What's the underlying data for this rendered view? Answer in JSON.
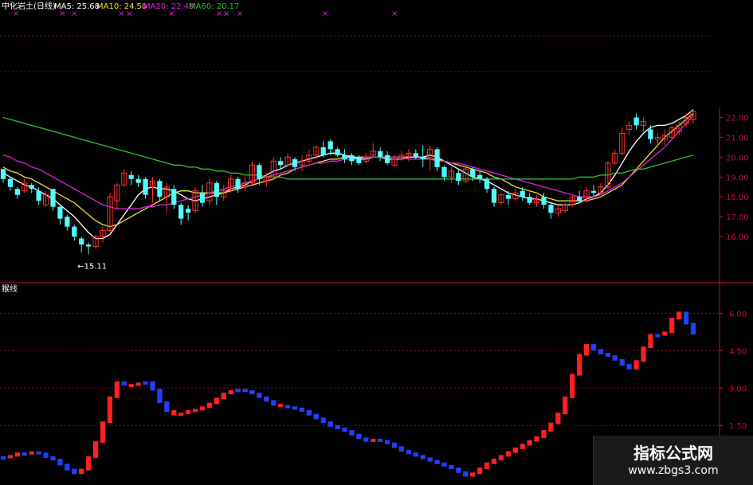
{
  "header": {
    "name": "中化岩土(日线)",
    "ma5_label": "MA5: 25.68",
    "ma10_label": "MA10: 24.50",
    "ma20_label": "MA20: 22.48",
    "ma60_label": "MA60: 20.17"
  },
  "lower_label": "猴线",
  "watermark": {
    "title": "指标公式网",
    "url": "www.zbgs3.com"
  },
  "colors": {
    "bg": "#000000",
    "grid": "#7a0a2a",
    "axis": "#c0103a",
    "up": "#ff3030",
    "down": "#54fcfc",
    "ma5": "#ffffff",
    "ma10": "#f0e040",
    "ma20": "#e020e0",
    "ma60": "#30c030",
    "ind_up": "#ff2020",
    "ind_down": "#2040ff"
  },
  "chart_data": [
    {
      "type": "candlestick",
      "title": "中化岩土(日线)",
      "ylim": [
        15.0,
        22.5
      ],
      "yticks": [
        16.0,
        17.0,
        18.0,
        19.0,
        20.0,
        21.0,
        22.0
      ],
      "ytick_labels": [
        "16.00",
        "17.00",
        "18.00",
        "19.00",
        "20.00",
        "21.00",
        "22.00"
      ],
      "low_annotation": "←15.11",
      "low_annotation_value": 15.11,
      "ohlc": [
        [
          19.4,
          19.4,
          18.7,
          18.9
        ],
        [
          18.9,
          19.0,
          18.3,
          18.5
        ],
        [
          18.4,
          18.5,
          17.9,
          18.1
        ],
        [
          18.3,
          18.9,
          18.2,
          18.7
        ],
        [
          18.6,
          18.7,
          18.2,
          18.4
        ],
        [
          18.3,
          18.5,
          17.6,
          17.8
        ],
        [
          17.6,
          18.3,
          17.5,
          18.1
        ],
        [
          18.4,
          18.4,
          17.3,
          17.5
        ],
        [
          17.5,
          17.6,
          16.6,
          16.9
        ],
        [
          17.0,
          17.1,
          16.3,
          16.5
        ],
        [
          16.5,
          16.6,
          15.8,
          16.0
        ],
        [
          15.9,
          16.0,
          15.2,
          15.6
        ],
        [
          15.6,
          15.7,
          15.11,
          15.5
        ],
        [
          15.5,
          16.1,
          15.4,
          16.0
        ],
        [
          16.0,
          16.5,
          15.7,
          16.3
        ],
        [
          16.3,
          18.2,
          16.2,
          18.0
        ],
        [
          17.8,
          18.7,
          17.4,
          18.6
        ],
        [
          18.6,
          19.4,
          18.5,
          19.2
        ],
        [
          19.1,
          19.3,
          18.6,
          18.9
        ],
        [
          18.9,
          19.1,
          18.5,
          18.7
        ],
        [
          18.9,
          19.0,
          17.9,
          18.1
        ],
        [
          18.5,
          19.0,
          17.7,
          18.8
        ],
        [
          18.8,
          18.9,
          17.8,
          18.0
        ],
        [
          18.0,
          18.7,
          17.2,
          18.5
        ],
        [
          18.4,
          18.6,
          17.4,
          17.6
        ],
        [
          17.6,
          17.7,
          16.6,
          16.9
        ],
        [
          17.4,
          17.6,
          16.8,
          17.2
        ],
        [
          17.3,
          18.5,
          17.2,
          18.3
        ],
        [
          18.2,
          18.6,
          17.5,
          17.7
        ],
        [
          17.8,
          18.9,
          17.6,
          18.7
        ],
        [
          18.7,
          18.8,
          17.6,
          18.0
        ],
        [
          18.0,
          18.6,
          17.8,
          18.3
        ],
        [
          18.4,
          19.1,
          18.2,
          18.9
        ],
        [
          18.9,
          19.0,
          18.2,
          18.4
        ],
        [
          18.5,
          19.0,
          18.3,
          18.7
        ],
        [
          18.7,
          19.8,
          18.6,
          19.6
        ],
        [
          19.6,
          19.7,
          18.6,
          18.9
        ],
        [
          18.8,
          19.2,
          18.5,
          19.0
        ],
        [
          19.0,
          20.0,
          18.9,
          19.8
        ],
        [
          19.8,
          20.0,
          19.4,
          19.6
        ],
        [
          19.6,
          20.2,
          19.5,
          20.0
        ],
        [
          19.9,
          20.0,
          19.3,
          19.5
        ],
        [
          19.6,
          20.1,
          19.3,
          19.8
        ],
        [
          19.8,
          20.4,
          19.7,
          20.1
        ],
        [
          20.1,
          20.6,
          19.9,
          20.5
        ],
        [
          20.5,
          20.8,
          20.0,
          20.1
        ],
        [
          20.8,
          20.9,
          20.1,
          20.4
        ],
        [
          20.4,
          20.5,
          20.0,
          20.1
        ],
        [
          20.1,
          20.4,
          19.7,
          19.9
        ],
        [
          20.1,
          20.2,
          19.6,
          19.8
        ],
        [
          20.0,
          20.1,
          19.6,
          19.7
        ],
        [
          19.8,
          20.2,
          19.7,
          20.0
        ],
        [
          20.1,
          20.7,
          20.0,
          20.3
        ],
        [
          20.3,
          20.5,
          19.8,
          20.0
        ],
        [
          20.1,
          20.3,
          19.6,
          19.7
        ],
        [
          19.6,
          20.1,
          19.5,
          19.9
        ],
        [
          19.9,
          20.3,
          19.8,
          20.1
        ],
        [
          20.1,
          20.4,
          19.8,
          20.2
        ],
        [
          20.2,
          20.4,
          19.9,
          20.0
        ],
        [
          20.0,
          20.6,
          19.5,
          19.9
        ],
        [
          20.0,
          20.6,
          19.3,
          20.4
        ],
        [
          20.4,
          20.5,
          19.3,
          19.5
        ],
        [
          19.5,
          19.6,
          18.8,
          19.0
        ],
        [
          19.0,
          19.5,
          18.7,
          19.3
        ],
        [
          19.2,
          19.4,
          18.6,
          18.8
        ],
        [
          18.8,
          19.5,
          18.7,
          19.4
        ],
        [
          19.4,
          19.5,
          18.8,
          19.0
        ],
        [
          19.1,
          19.3,
          18.7,
          18.9
        ],
        [
          18.9,
          19.0,
          18.2,
          18.4
        ],
        [
          18.4,
          18.5,
          17.5,
          17.7
        ],
        [
          17.7,
          18.2,
          17.6,
          18.1
        ],
        [
          18.1,
          18.3,
          17.6,
          17.9
        ],
        [
          17.9,
          18.4,
          17.8,
          18.2
        ],
        [
          18.3,
          18.5,
          17.8,
          18.0
        ],
        [
          18.0,
          18.2,
          17.6,
          17.7
        ],
        [
          17.7,
          18.1,
          17.5,
          17.9
        ],
        [
          18.0,
          18.2,
          17.4,
          17.6
        ],
        [
          17.6,
          17.7,
          16.9,
          17.2
        ],
        [
          17.2,
          17.6,
          17.0,
          17.4
        ],
        [
          17.3,
          17.7,
          17.2,
          17.6
        ],
        [
          17.6,
          18.1,
          17.5,
          18.0
        ],
        [
          18.0,
          18.3,
          17.7,
          17.8
        ],
        [
          17.8,
          18.5,
          17.7,
          18.3
        ],
        [
          18.3,
          18.6,
          18.0,
          18.2
        ],
        [
          18.2,
          18.7,
          18.1,
          18.5
        ],
        [
          18.5,
          19.8,
          18.4,
          19.7
        ],
        [
          19.7,
          20.4,
          19.6,
          20.2
        ],
        [
          20.2,
          21.5,
          20.1,
          21.2
        ],
        [
          21.4,
          21.8,
          21.1,
          21.6
        ],
        [
          22.0,
          22.2,
          21.4,
          21.6
        ],
        [
          21.6,
          22.0,
          21.3,
          21.8
        ],
        [
          21.4,
          21.6,
          20.7,
          20.9
        ],
        [
          20.9,
          21.2,
          20.5,
          21.0
        ],
        [
          20.9,
          21.4,
          20.6,
          21.1
        ],
        [
          21.0,
          21.6,
          20.9,
          21.5
        ],
        [
          21.3,
          21.8,
          21.1,
          21.6
        ],
        [
          21.7,
          22.2,
          21.5,
          22.0
        ],
        [
          21.9,
          22.4,
          21.7,
          22.3
        ]
      ],
      "series": [
        {
          "name": "MA5",
          "color": "#ffffff",
          "values": [
            19.2,
            19.0,
            18.8,
            18.6,
            18.5,
            18.3,
            18.1,
            17.9,
            17.6,
            17.3,
            17.0,
            16.6,
            16.2,
            15.9,
            15.9,
            16.1,
            16.6,
            17.1,
            17.6,
            18.1,
            18.4,
            18.5,
            18.4,
            18.4,
            18.3,
            18.1,
            17.9,
            17.8,
            17.9,
            18.0,
            18.1,
            18.2,
            18.4,
            18.5,
            18.6,
            18.8,
            18.9,
            19.1,
            19.3,
            19.4,
            19.6,
            19.7,
            19.8,
            19.9,
            20.0,
            20.1,
            20.2,
            20.2,
            20.1,
            20.0,
            19.9,
            19.9,
            20.0,
            20.0,
            19.9,
            19.9,
            19.9,
            20.0,
            20.0,
            20.0,
            20.1,
            20.0,
            19.8,
            19.6,
            19.4,
            19.2,
            19.0,
            18.9,
            18.8,
            18.6,
            18.4,
            18.2,
            18.1,
            18.0,
            17.9,
            17.9,
            17.8,
            17.7,
            17.6,
            17.6,
            17.6,
            17.7,
            17.9,
            18.0,
            18.2,
            18.6,
            19.1,
            19.7,
            20.3,
            20.8,
            21.2,
            21.5,
            21.6,
            21.6,
            21.7,
            21.9,
            22.1,
            22.4
          ]
        },
        {
          "name": "MA10",
          "color": "#f0e040",
          "values": [
            19.5,
            19.3,
            19.2,
            19.0,
            18.9,
            18.7,
            18.5,
            18.3,
            18.1,
            17.9,
            17.7,
            17.4,
            17.1,
            16.8,
            16.6,
            16.5,
            16.6,
            16.8,
            17.0,
            17.2,
            17.4,
            17.6,
            17.8,
            18.0,
            18.2,
            18.3,
            18.3,
            18.2,
            18.2,
            18.2,
            18.2,
            18.2,
            18.3,
            18.4,
            18.5,
            18.6,
            18.7,
            18.8,
            18.9,
            19.1,
            19.2,
            19.4,
            19.5,
            19.6,
            19.7,
            19.8,
            19.9,
            19.9,
            20.0,
            20.0,
            20.0,
            20.0,
            20.0,
            20.0,
            20.0,
            20.0,
            20.0,
            20.0,
            20.0,
            20.0,
            19.9,
            19.9,
            19.8,
            19.7,
            19.6,
            19.5,
            19.4,
            19.3,
            19.2,
            19.0,
            18.9,
            18.7,
            18.5,
            18.4,
            18.3,
            18.2,
            18.0,
            17.9,
            17.8,
            17.8,
            17.8,
            17.8,
            17.8,
            17.9,
            18.0,
            18.2,
            18.4,
            18.6,
            19.0,
            19.4,
            19.8,
            20.2,
            20.6,
            21.0,
            21.3,
            21.6,
            21.9,
            22.2
          ]
        },
        {
          "name": "MA20",
          "color": "#e020e0",
          "values": [
            20.1,
            20.0,
            19.8,
            19.7,
            19.5,
            19.4,
            19.2,
            19.0,
            18.8,
            18.6,
            18.4,
            18.2,
            18.0,
            17.8,
            17.6,
            17.5,
            17.4,
            17.4,
            17.4,
            17.4,
            17.5,
            17.5,
            17.6,
            17.6,
            17.7,
            17.8,
            17.9,
            18.0,
            18.1,
            18.2,
            18.3,
            18.4,
            18.5,
            18.6,
            18.7,
            18.8,
            18.9,
            19.0,
            19.1,
            19.2,
            19.3,
            19.4,
            19.5,
            19.6,
            19.7,
            19.7,
            19.8,
            19.8,
            19.9,
            19.9,
            19.9,
            20.0,
            20.0,
            20.0,
            20.0,
            20.0,
            20.0,
            19.9,
            19.9,
            19.9,
            19.9,
            19.8,
            19.8,
            19.7,
            19.7,
            19.6,
            19.5,
            19.4,
            19.3,
            19.2,
            19.1,
            19.0,
            18.9,
            18.8,
            18.7,
            18.6,
            18.5,
            18.4,
            18.3,
            18.2,
            18.1,
            18.0,
            18.0,
            18.0,
            18.1,
            18.3,
            18.5,
            18.7,
            19.0,
            19.3,
            19.6,
            19.9,
            20.2,
            20.5,
            20.9,
            21.3,
            21.7,
            22.1
          ]
        },
        {
          "name": "MA60",
          "color": "#30c030",
          "values": [
            22.0,
            21.9,
            21.8,
            21.7,
            21.6,
            21.5,
            21.4,
            21.3,
            21.2,
            21.1,
            21.0,
            20.9,
            20.8,
            20.7,
            20.6,
            20.5,
            20.4,
            20.3,
            20.2,
            20.1,
            20.0,
            19.9,
            19.8,
            19.7,
            19.6,
            19.6,
            19.5,
            19.5,
            19.4,
            19.4,
            19.3,
            19.3,
            19.2,
            19.2,
            19.1,
            19.1,
            19.1,
            19.0,
            19.0,
            19.0,
            18.9,
            18.9,
            18.9,
            18.9,
            18.9,
            18.9,
            18.9,
            18.9,
            18.9,
            18.9,
            18.9,
            18.9,
            18.9,
            18.9,
            18.9,
            18.9,
            18.9,
            18.9,
            18.9,
            18.9,
            18.9,
            18.9,
            18.9,
            18.9,
            18.9,
            18.9,
            18.9,
            18.9,
            18.9,
            18.9,
            18.9,
            18.9,
            18.9,
            18.9,
            18.9,
            18.9,
            18.9,
            18.9,
            18.9,
            18.9,
            18.9,
            19.0,
            19.0,
            19.0,
            19.1,
            19.1,
            19.2,
            19.2,
            19.3,
            19.4,
            19.4,
            19.5,
            19.6,
            19.7,
            19.8,
            19.9,
            20.0,
            20.1
          ]
        }
      ]
    },
    {
      "type": "bar",
      "title": "猴线",
      "ylim": [
        -0.6,
        7.0
      ],
      "yticks": [
        1.5,
        3.0,
        4.5,
        6.0
      ],
      "ytick_labels": [
        "1.50",
        "3.00",
        "4.50",
        "6.00"
      ],
      "values": [
        0.2,
        0.25,
        0.35,
        0.35,
        0.4,
        0.35,
        0.2,
        0.1,
        -0.1,
        -0.3,
        -0.45,
        -0.3,
        0.2,
        0.8,
        1.6,
        2.6,
        3.2,
        3.1,
        3.1,
        3.15,
        3.2,
        2.9,
        2.4,
        2.05,
        1.9,
        1.95,
        2.05,
        2.1,
        2.2,
        2.35,
        2.55,
        2.75,
        2.85,
        2.9,
        2.85,
        2.75,
        2.6,
        2.45,
        2.3,
        2.25,
        2.2,
        2.15,
        2.05,
        1.9,
        1.75,
        1.6,
        1.45,
        1.35,
        1.25,
        1.1,
        0.95,
        0.85,
        0.9,
        0.85,
        0.75,
        0.6,
        0.45,
        0.35,
        0.25,
        0.15,
        0.05,
        -0.05,
        -0.15,
        -0.25,
        -0.4,
        -0.55,
        -0.45,
        -0.25,
        -0.05,
        0.1,
        0.25,
        0.4,
        0.55,
        0.7,
        0.85,
        1.0,
        1.25,
        1.55,
        1.95,
        2.6,
        3.5,
        4.3,
        4.7,
        4.5,
        4.35,
        4.25,
        4.1,
        3.9,
        3.75,
        4.05,
        4.6,
        5.1,
        5.1,
        5.2,
        5.75,
        6.0,
        5.55,
        5.15
      ],
      "colors": [
        "down",
        "up",
        "up",
        "down",
        "up",
        "down",
        "down",
        "down",
        "down",
        "down",
        "down",
        "up",
        "up",
        "up",
        "up",
        "up",
        "up",
        "down",
        "up",
        "up",
        "down",
        "down",
        "down",
        "down",
        "up",
        "up",
        "up",
        "up",
        "up",
        "up",
        "up",
        "up",
        "up",
        "down",
        "down",
        "down",
        "down",
        "down",
        "down",
        "up",
        "down",
        "down",
        "down",
        "down",
        "down",
        "down",
        "down",
        "down",
        "down",
        "down",
        "down",
        "down",
        "up",
        "down",
        "down",
        "down",
        "down",
        "down",
        "down",
        "down",
        "down",
        "down",
        "down",
        "down",
        "down",
        "down",
        "up",
        "up",
        "up",
        "up",
        "up",
        "up",
        "up",
        "up",
        "up",
        "up",
        "up",
        "up",
        "up",
        "up",
        "up",
        "up",
        "up",
        "down",
        "down",
        "down",
        "down",
        "down",
        "down",
        "up",
        "up",
        "up",
        "down",
        "up",
        "up",
        "up",
        "down",
        "down"
      ]
    }
  ]
}
